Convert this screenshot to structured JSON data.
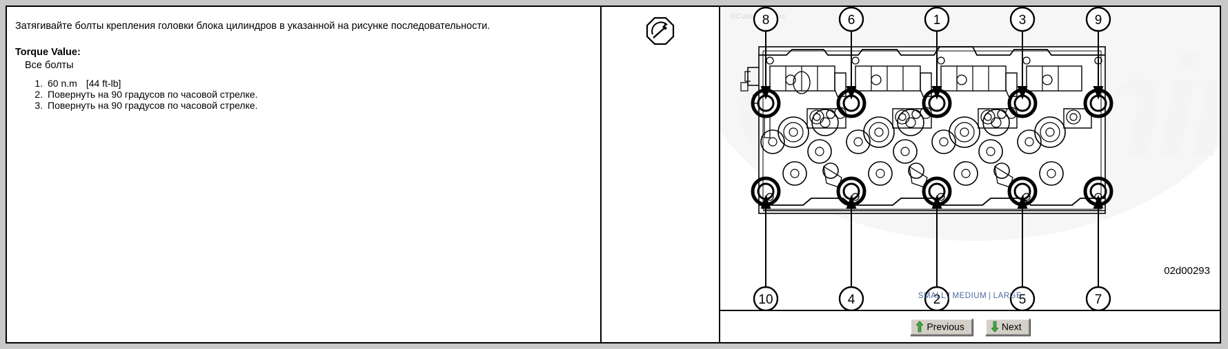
{
  "document": {
    "instruction": "Затягивайте болты крепления головки блока цилиндров в указанной на рисунке последовательности.",
    "torque_heading": "Torque Value:",
    "torque_subject": "Все болты",
    "steps": [
      {
        "value": "60 n.m",
        "alt": "[44 ft-lb]"
      },
      {
        "value": "Повернуть на 90 градусов по часовой стрелке.",
        "alt": ""
      },
      {
        "value": "Повернуть на 90 градусов по часовой стрелке.",
        "alt": ""
      }
    ]
  },
  "icon_cell": {
    "icon": "torque-wrench-icon"
  },
  "figure": {
    "copyright": "©Cummins Inc",
    "watermark": "Cummins",
    "image_id": "02d00293",
    "callouts_top": [
      "8",
      "6",
      "1",
      "3",
      "9"
    ],
    "callouts_bottom": [
      "10",
      "4",
      "2",
      "5",
      "7"
    ],
    "size_links": [
      {
        "label": "SMALL"
      },
      {
        "label": "MEDIUM"
      },
      {
        "label": "LARGE"
      }
    ],
    "link_color": "#4a6a9e"
  },
  "navigation": {
    "previous_label": "Previous",
    "next_label": "Next",
    "arrow_color": "#3fa73f"
  }
}
